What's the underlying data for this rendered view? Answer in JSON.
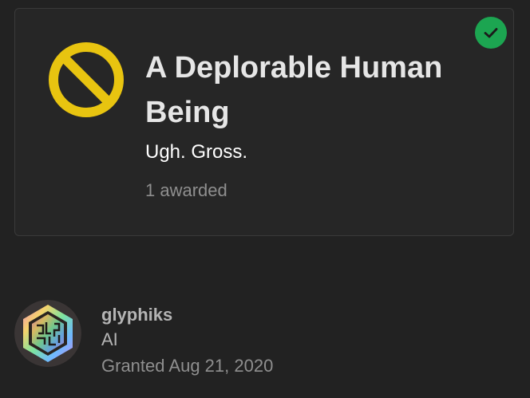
{
  "badge": {
    "title": "A Deplorable Human Being",
    "description": "Ugh. Gross.",
    "awarded_count": "1 awarded",
    "icon": "no-entry-circle-icon",
    "icon_color": "#e8c410",
    "granted_indicator": "check-icon",
    "granted_color": "#1ca551"
  },
  "user": {
    "username": "glyphiks",
    "title": "AI",
    "granted_label": "Granted",
    "granted_date": "Aug 21, 2020",
    "avatar": "holographic-hexagon-glyph-avatar"
  },
  "colors": {
    "background": "#222222",
    "card_background": "#262626",
    "card_border": "#3a3a3a",
    "primary_text": "#e6e6e6",
    "muted_text": "#8f8f8f"
  }
}
